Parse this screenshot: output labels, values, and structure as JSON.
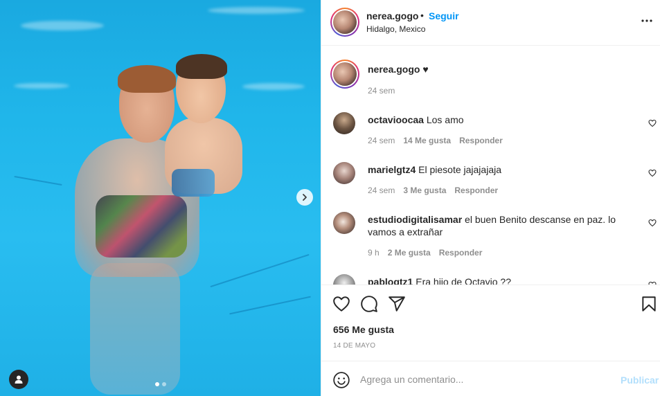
{
  "post": {
    "username": "nerea.gogo",
    "follow_label": "Seguir",
    "separator": "•",
    "location": "Hidalgo, Mexico",
    "caption_user": "nerea.gogo",
    "caption_text": "♥",
    "caption_time": "24 sem",
    "likes": "656 Me gusta",
    "date": "14 DE MAYO"
  },
  "carousel": {
    "total": 2,
    "current": 1
  },
  "comments": [
    {
      "user": "octavioocaa",
      "text": "Los amo",
      "time": "24 sem",
      "likes": "14 Me gusta",
      "reply": "Responder"
    },
    {
      "user": "marielgtz4",
      "text": "El piesote jajajajaja",
      "time": "24 sem",
      "likes": "3 Me gusta",
      "reply": "Responder"
    },
    {
      "user": "estudiodigitalisamar",
      "text": "el buen Benito descanse en paz. lo vamos a extrañar",
      "time": "9 h",
      "likes": "2 Me gusta",
      "reply": "Responder"
    },
    {
      "user": "pablogtz1",
      "text": "Era hijo de Octavio ??"
    }
  ],
  "add_comment": {
    "placeholder": "Agrega un comentario...",
    "publish_label": "Publicar"
  },
  "colors": {
    "accent": "#0095f6",
    "publish_disabled": "#b2dffc",
    "muted": "#8e8e8e"
  },
  "icons": [
    "more-options-icon",
    "heart-icon",
    "comment-icon",
    "share-icon",
    "bookmark-icon",
    "emoji-icon",
    "chevron-right-icon",
    "user-tag-icon"
  ]
}
